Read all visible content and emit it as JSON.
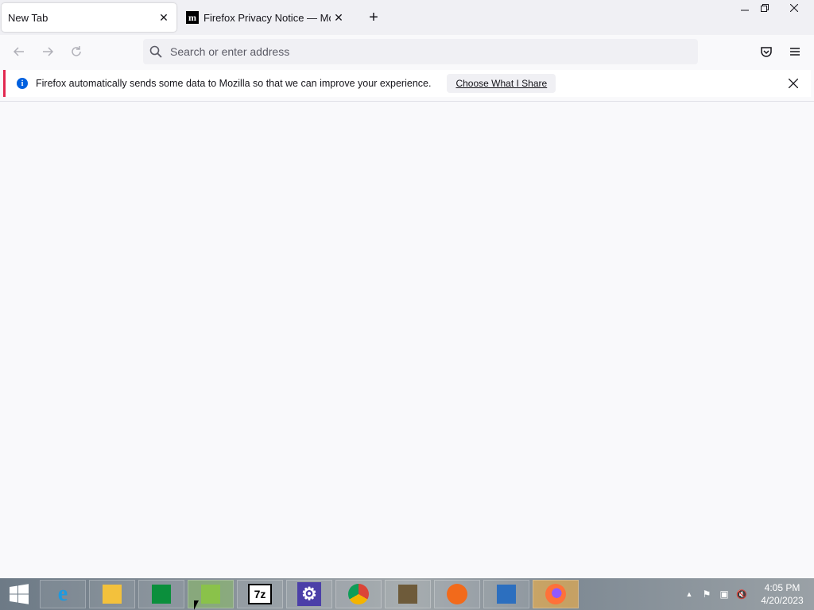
{
  "tabs": [
    {
      "label": "New Tab",
      "close": "✕"
    },
    {
      "label": "Firefox Privacy Notice — Mozilla",
      "favicon": "m",
      "close": "✕"
    }
  ],
  "tabstrip": {
    "new_tab": "+"
  },
  "window": {
    "minimize": "—",
    "restore": "❐",
    "close": "✕"
  },
  "nav": {
    "back": "←",
    "forward": "→",
    "reload": "↻",
    "url_placeholder": "Search or enter address",
    "pocket": "pocket-icon",
    "menu": "≡"
  },
  "notification": {
    "message": "Firefox automatically sends some data to Mozilla so that we can improve your experience.",
    "button": "Choose What I Share",
    "info": "i",
    "close": "✕"
  },
  "taskbar": {
    "apps": [
      {
        "name": "Internet Explorer",
        "glyph": "e",
        "color": "#1d9ae0"
      },
      {
        "name": "File Explorer",
        "glyph": "",
        "color": "#f3c13c"
      },
      {
        "name": "Store",
        "glyph": "",
        "color": "#0b8f3c"
      },
      {
        "name": "Notepad++",
        "glyph": "",
        "color": "#8ac24a"
      },
      {
        "name": "7-Zip",
        "glyph": "7z",
        "color": "#ffffff"
      },
      {
        "name": "Settings",
        "glyph": "⚙",
        "color": "#4b3fa8"
      },
      {
        "name": "Chrome",
        "glyph": "",
        "color": "#db4437"
      },
      {
        "name": "Archive",
        "glyph": "",
        "color": "#6e5b3a"
      },
      {
        "name": "Avast",
        "glyph": "",
        "color": "#f26a1b"
      },
      {
        "name": "Malwarebytes",
        "glyph": "",
        "color": "#2c6fbf"
      },
      {
        "name": "Firefox",
        "glyph": "",
        "color": "#ff7139"
      }
    ],
    "time": "4:05 PM",
    "date": "4/20/2023",
    "tray": {
      "chevron": "▲",
      "flag": "⚑",
      "network": "▣",
      "volume": "🔇"
    }
  }
}
